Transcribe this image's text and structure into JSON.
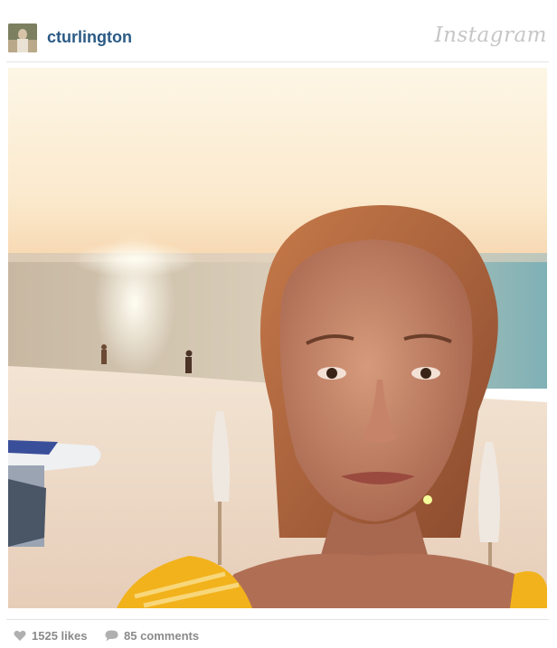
{
  "header": {
    "username": "cturlington",
    "logo_text": "Instagram"
  },
  "footer": {
    "likes_label": "1525 likes",
    "comments_label": "85 comments"
  },
  "colors": {
    "username": "#2a5a85",
    "muted": "#8a8a8a",
    "divider": "#e3e3e3"
  },
  "icons": {
    "like": "heart-icon",
    "comment": "speech-bubble-icon"
  }
}
